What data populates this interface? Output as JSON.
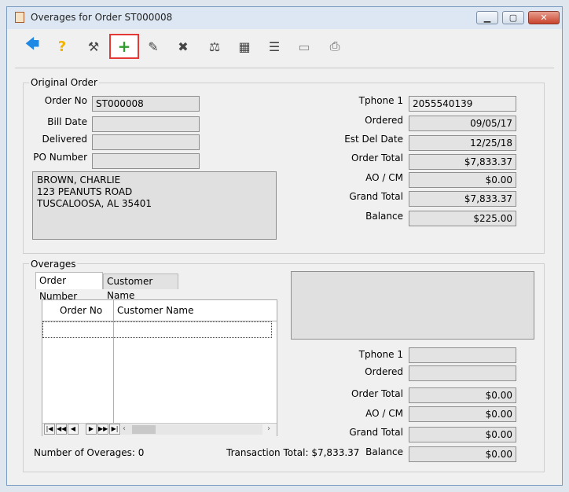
{
  "window": {
    "title": "Overages for Order ST000008"
  },
  "titlebar_buttons": {
    "minimize": "▁",
    "maximize": "▢",
    "close": "✕"
  },
  "toolbar": {
    "buttons": [
      {
        "name": "back",
        "glyph": "🡄"
      },
      {
        "name": "help",
        "glyph": "?"
      },
      {
        "name": "tools",
        "glyph": "⚒"
      },
      {
        "name": "add-overage",
        "glyph": "+"
      },
      {
        "name": "edit",
        "glyph": "✎"
      },
      {
        "name": "delete",
        "glyph": "✖"
      },
      {
        "name": "balance",
        "glyph": "⚖"
      },
      {
        "name": "register",
        "glyph": "▦"
      },
      {
        "name": "report",
        "glyph": "☰"
      },
      {
        "name": "document",
        "glyph": "▭"
      },
      {
        "name": "print",
        "glyph": "⎙"
      }
    ]
  },
  "original_order": {
    "legend": "Original Order",
    "order_no_label": "Order No",
    "order_no": "ST000008",
    "bill_date_label": "Bill Date",
    "bill_date": "",
    "delivered_label": "Delivered",
    "delivered": "",
    "po_number_label": "PO Number",
    "po_number": "",
    "address": [
      "BROWN, CHARLIE",
      "123 PEANUTS ROAD",
      "TUSCALOOSA, AL  35401"
    ],
    "tphone1_label": "Tphone 1",
    "tphone1": "2055540139",
    "ordered_label": "Ordered",
    "ordered": "09/05/17",
    "est_del_label": "Est Del Date",
    "est_del": "12/25/18",
    "order_total_label": "Order Total",
    "order_total": "$7,833.37",
    "ao_cm_label": "AO / CM",
    "ao_cm": "$0.00",
    "grand_total_label": "Grand Total",
    "grand_total": "$7,833.37",
    "balance_label": "Balance",
    "balance": "$225.00"
  },
  "overages": {
    "legend": "Overages",
    "tabs": [
      "Order Number",
      "Customer Name"
    ],
    "columns": [
      "Order No",
      "Customer Name"
    ],
    "nav": [
      "|◀",
      "◀◀",
      "◀",
      "▶",
      "▶▶",
      "▶|"
    ],
    "count_text": "Number of Overages: 0",
    "transaction_total_text": "Transaction Total: $7,833.37",
    "tphone1_label": "Tphone 1",
    "tphone1": "",
    "ordered_label": "Ordered",
    "ordered": "",
    "order_total_label": "Order Total",
    "order_total": "$0.00",
    "ao_cm_label": "AO / CM",
    "ao_cm": "$0.00",
    "grand_total_label": "Grand Total",
    "grand_total": "$0.00",
    "balance_label": "Balance",
    "balance": "$0.00"
  },
  "colors": {
    "highlight": "#e53935",
    "back_arrow": "#1e88e5",
    "help": "#f2b400",
    "add_plus": "#2e9d2e"
  }
}
